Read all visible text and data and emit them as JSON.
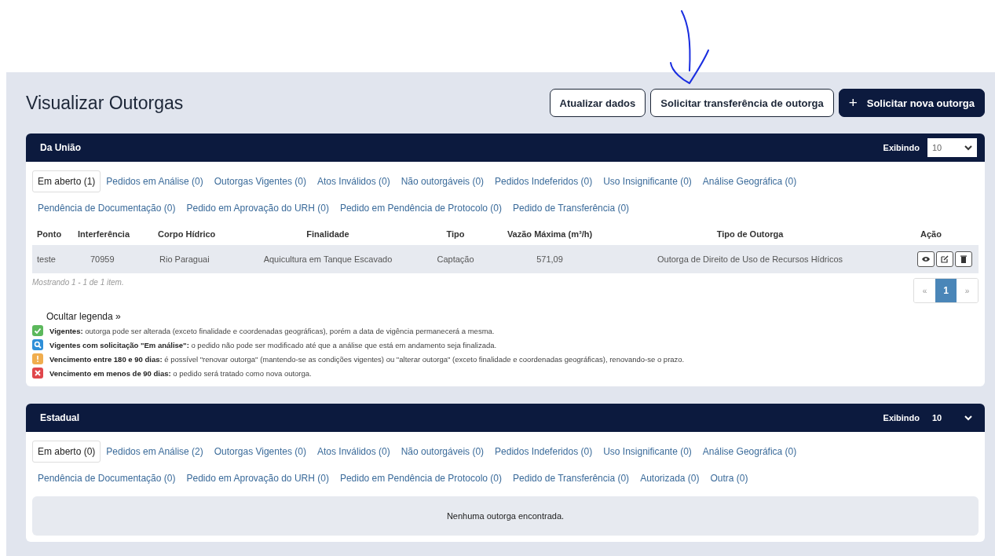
{
  "title": "Visualizar Outorgas",
  "actions": [
    {
      "label": "Atualizar dados",
      "kind": "outline"
    },
    {
      "label": "Solicitar transferência de outorga",
      "kind": "outline"
    },
    {
      "label": "Solicitar nova outorga",
      "kind": "primary",
      "icon": "+"
    }
  ],
  "annotation": {
    "kind": "arrow"
  },
  "sections": [
    {
      "title": "Da União",
      "show_label": "Exibindo",
      "page_size": "10",
      "select_highlighted": false,
      "tab_rows": [
        [
          {
            "label": "Em aberto (1)",
            "selected": true
          },
          {
            "label": "Pedidos em Análise (0)",
            "selected": false
          },
          {
            "label": "Outorgas Vigentes (0)",
            "selected": false
          },
          {
            "label": "Atos Inválidos (0)",
            "selected": false
          },
          {
            "label": "Não outorgáveis (0)",
            "selected": false
          },
          {
            "label": "Pedidos Indeferidos (0)",
            "selected": false
          },
          {
            "label": "Uso Insignificante (0)",
            "selected": false
          },
          {
            "label": "Análise Geográfica (0)",
            "selected": false
          }
        ],
        [
          {
            "label": "Pendência de Documentação (0)",
            "selected": false
          },
          {
            "label": "Pedido em Aprovação do URH (0)",
            "selected": false
          },
          {
            "label": "Pedido em Pendência de Protocolo (0)",
            "selected": false
          },
          {
            "label": "Pedido de Transferência (0)",
            "selected": false
          }
        ]
      ],
      "table": {
        "columns": [
          "Ponto",
          "Interferência",
          "Corpo Hídrico",
          "Finalidade",
          "Tipo",
          "Vazão Máxima (m³/h)",
          "Tipo de Outorga",
          "Ação"
        ],
        "rows": [
          {
            "cells": [
              "teste",
              "70959",
              "Rio Paraguai",
              "Aquicultura em Tanque Escavado",
              "Captação",
              "571,09",
              "Outorga de Direito de Uso de Recursos Hídricos"
            ],
            "actions": [
              {
                "kind": "view"
              },
              {
                "kind": "edit"
              },
              {
                "kind": "delete"
              }
            ]
          }
        ]
      },
      "summary": "Mostrando 1 - 1 de 1 item.",
      "pagination": [
        {
          "label": "«",
          "selected": false
        },
        {
          "label": "1",
          "selected": true
        },
        {
          "label": "»",
          "selected": false
        }
      ],
      "legend": {
        "toggle": "Ocultar legenda »",
        "items": [
          {
            "kind": "check",
            "text": "**Vigentes:** outorga pode ser alterada (exceto finalidade e coordenadas geográficas), porém a data de vigência permanecerá a mesma."
          },
          {
            "kind": "search",
            "text": "**Vigentes com solicitação \"Em análise\":** o pedido não pode ser modificado até que a análise que está em andamento seja finalizada."
          },
          {
            "kind": "warning",
            "text": "**Vencimento entre 180 e 90 dias:** é possível \"renovar outorga\" (mantendo-se as condições vigentes) ou \"alterar outorga\" (exceto finalidade e coordenadas geográficas), renovando-se o prazo."
          },
          {
            "kind": "error",
            "text": "**Vencimento em menos de 90 dias:** o pedido será tratado como nova outorga."
          }
        ]
      }
    },
    {
      "title": "Estadual",
      "show_label": "Exibindo",
      "page_size": "10",
      "select_highlighted": true,
      "tab_rows": [
        [
          {
            "label": "Em aberto (0)",
            "selected": true
          },
          {
            "label": "Pedidos em Análise (2)",
            "selected": false
          },
          {
            "label": "Outorgas Vigentes (0)",
            "selected": false
          },
          {
            "label": "Atos Inválidos (0)",
            "selected": false
          },
          {
            "label": "Não outorgáveis (0)",
            "selected": false
          },
          {
            "label": "Pedidos Indeferidos (0)",
            "selected": false
          },
          {
            "label": "Uso Insignificante (0)",
            "selected": false
          },
          {
            "label": "Análise Geográfica (0)",
            "selected": false
          }
        ],
        [
          {
            "label": "Pendência de Documentação (0)",
            "selected": false
          },
          {
            "label": "Pedido em Aprovação do URH (0)",
            "selected": false
          },
          {
            "label": "Pedido em Pendência de Protocolo (0)",
            "selected": false
          },
          {
            "label": "Pedido de Transferência (0)",
            "selected": false
          },
          {
            "label": "Autorizada (0)",
            "selected": false
          },
          {
            "label": "Outra (0)",
            "selected": false
          }
        ]
      ],
      "empty_message": "Nenhuma outorga encontrada."
    }
  ]
}
